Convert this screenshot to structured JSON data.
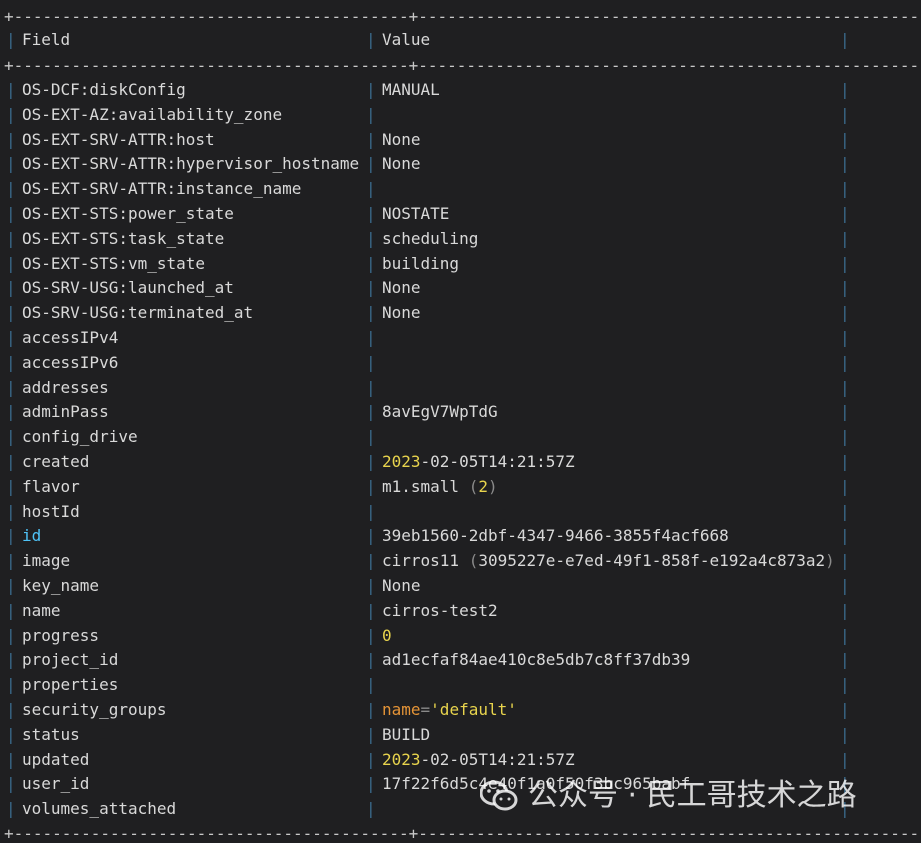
{
  "table": {
    "border": "+-----------------------------------------+-----------------------------------------------------+",
    "header": {
      "field": "Field",
      "value": "Value"
    },
    "rows": [
      {
        "field": "OS-DCF:diskConfig",
        "value": "MANUAL"
      },
      {
        "field": "OS-EXT-AZ:availability_zone",
        "value": ""
      },
      {
        "field": "OS-EXT-SRV-ATTR:host",
        "value": "None"
      },
      {
        "field": "OS-EXT-SRV-ATTR:hypervisor_hostname",
        "value": "None"
      },
      {
        "field": "OS-EXT-SRV-ATTR:instance_name",
        "value": ""
      },
      {
        "field": "OS-EXT-STS:power_state",
        "value": "NOSTATE"
      },
      {
        "field": "OS-EXT-STS:task_state",
        "value": "scheduling"
      },
      {
        "field": "OS-EXT-STS:vm_state",
        "value": "building"
      },
      {
        "field": "OS-SRV-USG:launched_at",
        "value": "None"
      },
      {
        "field": "OS-SRV-USG:terminated_at",
        "value": "None"
      },
      {
        "field": "accessIPv4",
        "value": ""
      },
      {
        "field": "accessIPv6",
        "value": ""
      },
      {
        "field": "addresses",
        "value": ""
      },
      {
        "field": "adminPass",
        "value": "8avEgV7WpTdG"
      },
      {
        "field": "config_drive",
        "value": ""
      },
      {
        "field": "created",
        "value_year": "2023",
        "value_rest": "-02-05T14:21:57Z"
      },
      {
        "field": "flavor",
        "value_main": "m1.small",
        "value_paren_open": "(",
        "value_num": "2",
        "value_paren_close": ")"
      },
      {
        "field": "hostId",
        "value": ""
      },
      {
        "field": "id",
        "value": "39eb1560-2dbf-4347-9466-3855f4acf668"
      },
      {
        "field": "image",
        "value_main": "cirros11",
        "value_paren_open": "(",
        "value_inner": "3095227e-e7ed-49f1-858f-e192a4c873a2",
        "value_paren_close": ")"
      },
      {
        "field": "key_name",
        "value": "None"
      },
      {
        "field": "name",
        "value": "cirros-test2"
      },
      {
        "field": "progress",
        "value": "0"
      },
      {
        "field": "project_id",
        "value": "ad1ecfaf84ae410c8e5db7c8ff37db39"
      },
      {
        "field": "properties",
        "value": ""
      },
      {
        "field": "security_groups",
        "value_key": "name",
        "value_eq": "=",
        "value_str": "'default'"
      },
      {
        "field": "status",
        "value": "BUILD"
      },
      {
        "field": "updated",
        "value_year": "2023",
        "value_rest": "-02-05T14:21:57Z"
      },
      {
        "field": "user_id",
        "value": "17f22f6d5c4e40f1a0f50f3bc965babf"
      },
      {
        "field": "volumes_attached",
        "value": ""
      }
    ]
  },
  "watermark": {
    "icon": "wechat-icon",
    "text": "公众号 · 民工哥技术之路"
  },
  "colors": {
    "background": "#1f1f21",
    "text": "#d9d9d9",
    "pipe": "#3a6a8c",
    "number": "#e8d44d",
    "key": "#e59437",
    "id": "#4fc3f7"
  }
}
